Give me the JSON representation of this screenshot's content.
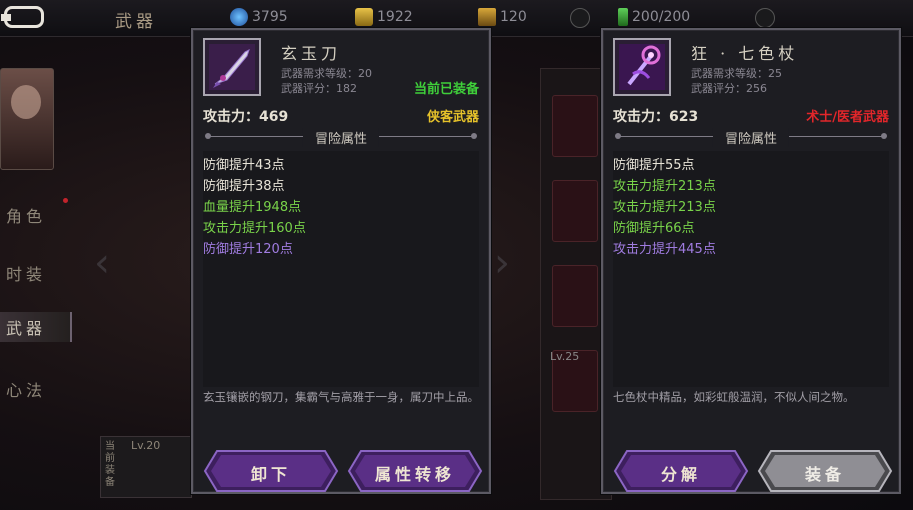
{
  "topbar": {
    "title": "武器",
    "resources": [
      {
        "icon": "gem-icon",
        "value": "3795"
      },
      {
        "icon": "gold-ingot-icon",
        "value": "1922"
      },
      {
        "icon": "coupon-icon",
        "value": "120"
      },
      {
        "icon": "stamina-icon",
        "value": "200/200"
      }
    ]
  },
  "sidebar": {
    "items": [
      {
        "label": "角色"
      },
      {
        "label": "时装"
      },
      {
        "label": "武器"
      },
      {
        "label": "心法"
      }
    ]
  },
  "background": {
    "level_label": "Lv.25",
    "level_label_2": "Lv.20",
    "equipped_mark": "当前装备"
  },
  "left_panel": {
    "name": "玄玉刀",
    "req_level": "武器需求等级：20",
    "score": "武器评分：182",
    "status": "当前已装备",
    "attack": "攻击力：469",
    "weapon_class": "侠客武器",
    "section_title": "冒险属性",
    "attributes": [
      {
        "text": "防御提升43点",
        "color": "#e8e4d8"
      },
      {
        "text": "防御提升38点",
        "color": "#e8e4d8"
      },
      {
        "text": "血量提升1948点",
        "color": "#79d34a"
      },
      {
        "text": "攻击力提升160点",
        "color": "#79d34a"
      },
      {
        "text": "防御提升120点",
        "color": "#a07ce0"
      }
    ],
    "description": "玄玉镶嵌的钢刀，集霸气与高雅于一身，属刀中上品。",
    "buttons": [
      "卸下",
      "属性转移"
    ]
  },
  "right_panel": {
    "name": "狂 · 七色杖",
    "req_level": "武器需求等级：25",
    "score": "武器评分：256",
    "attack": "攻击力：623",
    "weapon_class": "术士/医者武器",
    "section_title": "冒险属性",
    "attributes": [
      {
        "text": "防御提升55点",
        "color": "#e8e4d8"
      },
      {
        "text": "攻击力提升213点",
        "color": "#79d34a"
      },
      {
        "text": "攻击力提升213点",
        "color": "#79d34a"
      },
      {
        "text": "防御提升66点",
        "color": "#79d34a"
      },
      {
        "text": "攻击力提升445点",
        "color": "#a07ce0"
      }
    ],
    "description": "七色杖中精品，如彩虹般温润，不似人间之物。",
    "buttons": [
      "分解",
      "装备"
    ]
  },
  "colors": {
    "status_green": "#3fcf3a",
    "class_yellow": "#e6c22a",
    "class_red": "#e2262a",
    "button_purple": "#5a2f86",
    "button_gray": "#8f8e94"
  }
}
